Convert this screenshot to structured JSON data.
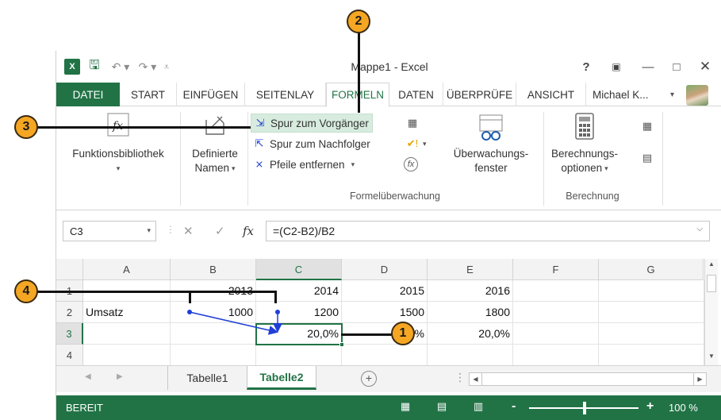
{
  "window": {
    "title": "Mappe1 - Excel",
    "user_name": "Michael K..."
  },
  "qat": {
    "logo": "X",
    "save_icon": "save-icon",
    "undo_icon": "undo-icon",
    "redo_icon": "redo-icon"
  },
  "tabs": [
    {
      "label": "DATEI"
    },
    {
      "label": "START"
    },
    {
      "label": "EINFÜGEN"
    },
    {
      "label": "SEITENLAY"
    },
    {
      "label": "FORMELN"
    },
    {
      "label": "DATEN"
    },
    {
      "label": "ÜBERPRÜFE"
    },
    {
      "label": "ANSICHT"
    }
  ],
  "ribbon": {
    "funktionsbibliothek": "Funktionsbibliothek",
    "definierte_namen_1": "Definierte",
    "definierte_namen_2": "Namen",
    "spur_vorgaenger": "Spur zum Vorgänger",
    "spur_nachfolger": "Spur zum Nachfolger",
    "pfeile_entfernen": "Pfeile entfernen",
    "ueberwachung_1": "Überwachungs-",
    "ueberwachung_2": "fenster",
    "berechnung_1": "Berechnungs-",
    "berechnung_2": "optionen",
    "group_formelueberwachung": "Formelüberwachung",
    "group_berechnung": "Berechnung"
  },
  "formula_bar": {
    "name_box": "C3",
    "formula": "=(C2-B2)/B2"
  },
  "grid": {
    "columns": [
      "A",
      "B",
      "C",
      "D",
      "E",
      "F",
      "G"
    ],
    "rows": [
      "1",
      "2",
      "3",
      "4"
    ],
    "cells": {
      "A2": "Umsatz",
      "B1": "2013",
      "C1": "2014",
      "D1": "2015",
      "E1": "2016",
      "B2": "1000",
      "C2": "1200",
      "D2": "1500",
      "E2": "1800",
      "C3": "20,0%",
      "D3": "25,0%",
      "E3": "20,0%"
    }
  },
  "sheets": [
    {
      "label": "Tabelle1"
    },
    {
      "label": "Tabelle2"
    }
  ],
  "status": {
    "text": "BEREIT",
    "zoom": "100 %"
  },
  "callouts": [
    "1",
    "2",
    "3",
    "4"
  ],
  "colors": {
    "excel_green": "#217346",
    "callout_orange": "#f5a623",
    "trace_arrow": "#1f3fd6"
  }
}
